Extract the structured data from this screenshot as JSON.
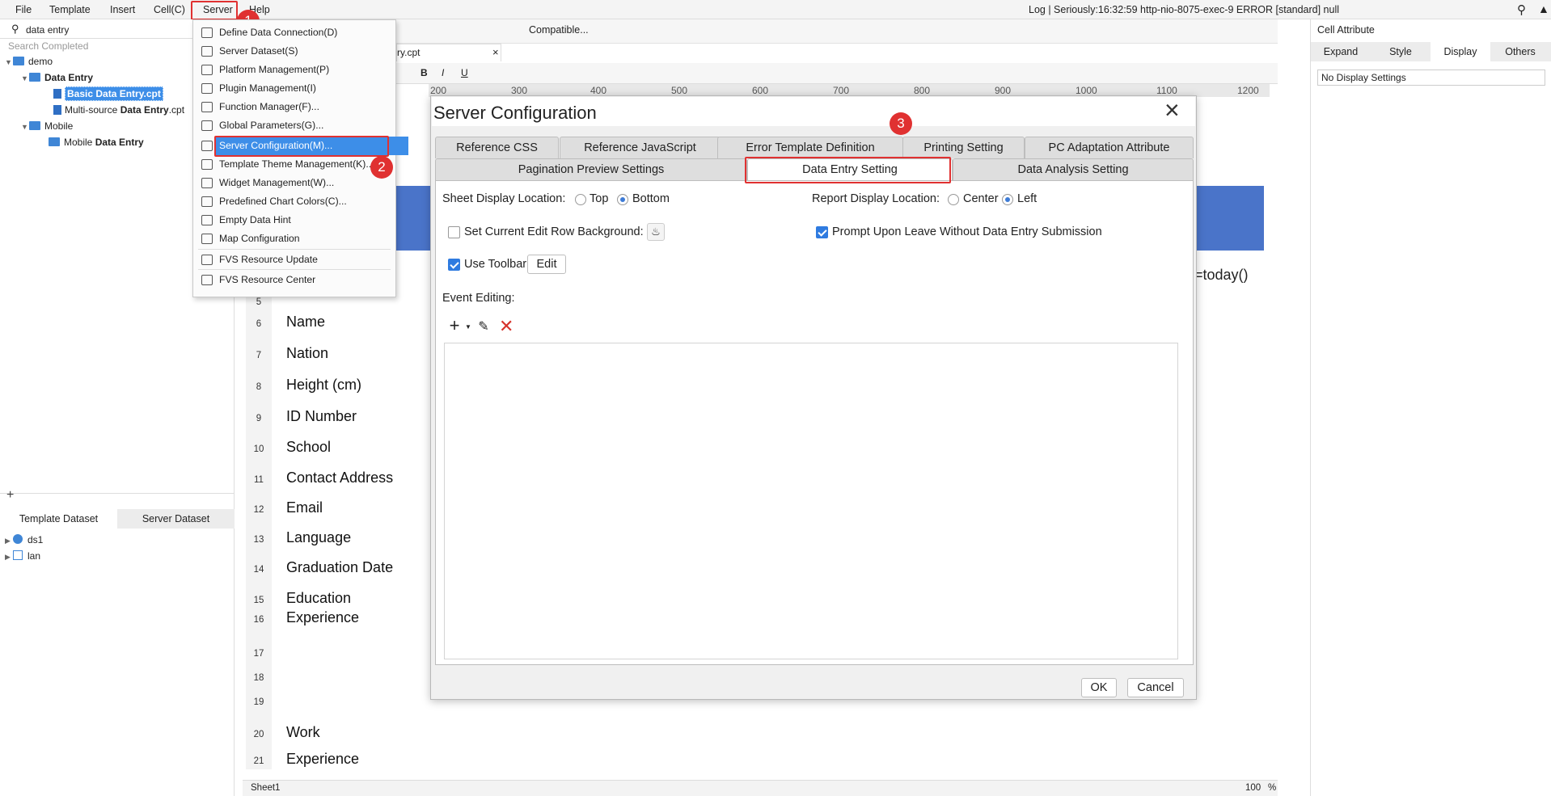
{
  "menubar": {
    "items": [
      "File",
      "Template",
      "Insert",
      "Cell(C)",
      "Server",
      "Help"
    ],
    "log": "Log | Seriously:16:32:59 http-nio-8075-exec-9 ERROR [standard] null"
  },
  "left": {
    "search_value": "data entry",
    "search_status": "Search Completed",
    "tree": {
      "root": "demo",
      "folder1": "Data Entry",
      "file1": "Basic Data Entry.cpt",
      "file2_prefix": "Multi-source ",
      "file2_bold": "Data Entry",
      "file2_suffix": ".cpt",
      "folder2": "Mobile",
      "file3_prefix": "Mobile ",
      "file3_bold": "Data Entry"
    },
    "dataset_tabs": [
      "Template Dataset",
      "Server Dataset"
    ],
    "datasets": [
      "ds1",
      "lan"
    ]
  },
  "server_menu": {
    "items": [
      "Define Data Connection(D)",
      "Server Dataset(S)",
      "Platform Management(P)",
      "Plugin Management(I)",
      "Function Manager(F)...",
      "Global Parameters(G)...",
      "Server Configuration(M)...",
      "Template Theme Management(K)...",
      "Widget Management(W)...",
      "Predefined Chart Colors(C)...",
      "Empty Data Hint",
      "Map Configuration",
      "FVS Resource Update",
      "FVS Resource Center"
    ]
  },
  "editor": {
    "file_tab": "ry.cpt",
    "compatible": "Compatible...",
    "formula": "=today()",
    "ruler": [
      "200",
      "300",
      "400",
      "500",
      "600",
      "700",
      "800",
      "900",
      "1000",
      "1100",
      "1200"
    ],
    "rows": [
      {
        "n": "5",
        "label": ""
      },
      {
        "n": "6",
        "label": "Name"
      },
      {
        "n": "7",
        "label": "Nation"
      },
      {
        "n": "8",
        "label": "Height (cm)"
      },
      {
        "n": "9",
        "label": "ID Number"
      },
      {
        "n": "10",
        "label": "School"
      },
      {
        "n": "11",
        "label": "Contact Address"
      },
      {
        "n": "12",
        "label": "Email"
      },
      {
        "n": "13",
        "label": "Language"
      },
      {
        "n": "14",
        "label": "Graduation Date"
      },
      {
        "n": "15",
        "label": "Education"
      },
      {
        "n": "16",
        "label": "Experience"
      },
      {
        "n": "17",
        "label": ""
      },
      {
        "n": "18",
        "label": ""
      },
      {
        "n": "19",
        "label": ""
      },
      {
        "n": "20",
        "label": "Work"
      },
      {
        "n": "21",
        "label": "Experience"
      }
    ],
    "sheet_tab": "Sheet1",
    "zoom": "100",
    "zoom_unit": "%"
  },
  "dialog": {
    "title": "Server Configuration",
    "tabs_row1": [
      "Reference CSS",
      "Reference JavaScript",
      "Error Template Definition",
      "Printing Setting",
      "PC Adaptation Attribute"
    ],
    "tabs_row2": [
      "Pagination Preview Settings",
      "Data Entry Setting",
      "Data Analysis Setting"
    ],
    "sheet_display_label": "Sheet Display Location:",
    "sheet_display_options": [
      "Top",
      "Bottom"
    ],
    "sheet_display_selected": "Bottom",
    "report_display_label": "Report Display Location:",
    "report_display_options": [
      "Center",
      "Left"
    ],
    "report_display_selected": "Left",
    "edit_row_bg_label": "Set Current Edit Row Background:",
    "edit_row_bg_checked": false,
    "prompt_leave_label": "Prompt Upon Leave Without Data Entry Submission",
    "prompt_leave_checked": true,
    "use_toolbar_label": "Use Toolbar",
    "use_toolbar_checked": true,
    "edit_button": "Edit",
    "event_editing_label": "Event Editing:",
    "ok": "OK",
    "cancel": "Cancel"
  },
  "right": {
    "title": "Cell Attribute",
    "tabs": [
      "Expand",
      "Style",
      "Display",
      "Others"
    ],
    "active_tab": "Display",
    "display_setting": "No Display Settings"
  },
  "badges": [
    "1",
    "2",
    "3"
  ],
  "colors": {
    "accent": "#2f7be0",
    "highlight": "#e03131",
    "selected_bg": "#3d8ee8"
  }
}
